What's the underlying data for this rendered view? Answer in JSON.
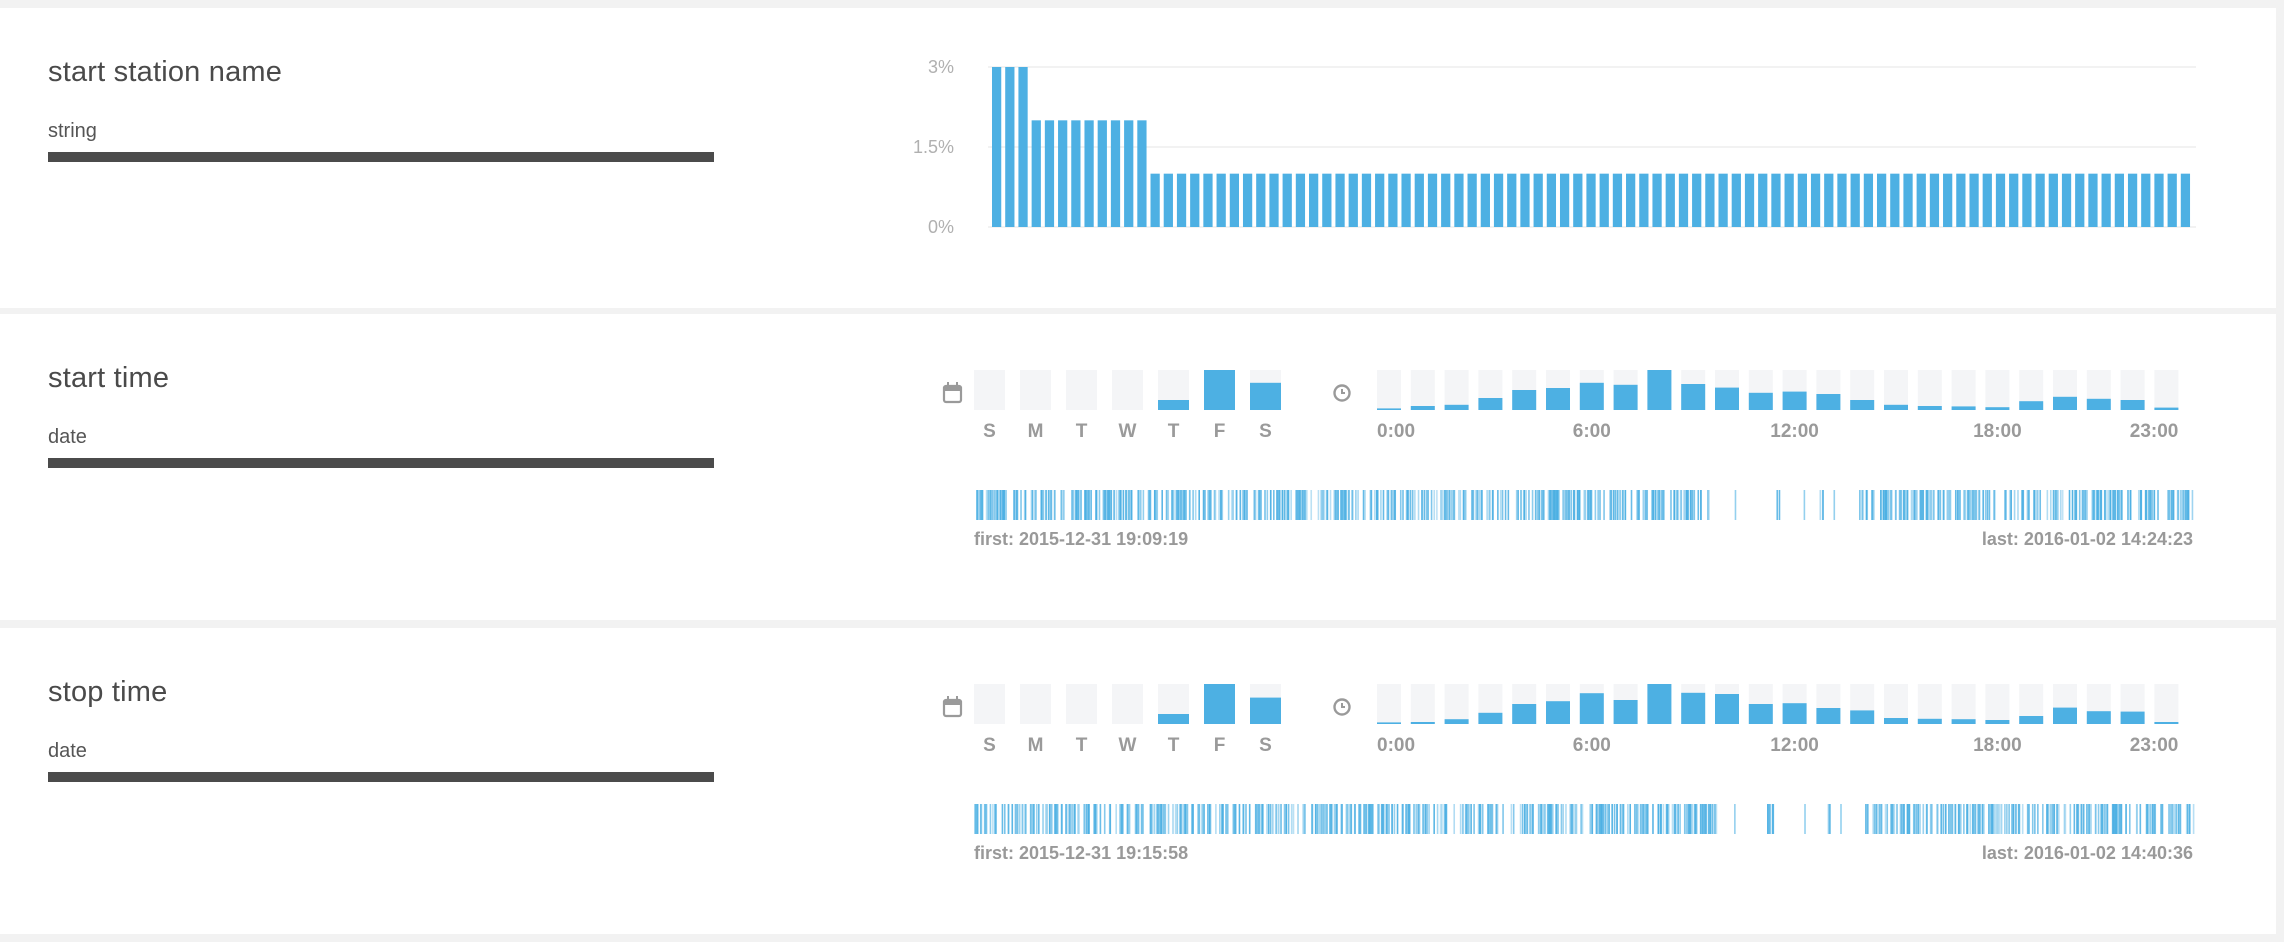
{
  "fields": [
    {
      "name": "start station name",
      "type": "string",
      "chart_data": {
        "type": "bar",
        "yticks": [
          "3%",
          "1.5%",
          "0%"
        ],
        "ylim": [
          0,
          3
        ],
        "values": [
          3,
          3,
          3,
          2,
          2,
          2,
          2,
          2,
          2,
          2,
          2,
          2,
          1,
          1,
          1,
          1,
          1,
          1,
          1,
          1,
          1,
          1,
          1,
          1,
          1,
          1,
          1,
          1,
          1,
          1,
          1,
          1,
          1,
          1,
          1,
          1,
          1,
          1,
          1,
          1,
          1,
          1,
          1,
          1,
          1,
          1,
          1,
          1,
          1,
          1,
          1,
          1,
          1,
          1,
          1,
          1,
          1,
          1,
          1,
          1,
          1,
          1,
          1,
          1,
          1,
          1,
          1,
          1,
          1,
          1,
          1,
          1,
          1,
          1,
          1,
          1,
          1,
          1,
          1,
          1,
          1,
          1,
          1,
          1,
          1,
          1,
          1,
          1,
          1,
          1,
          1
        ],
        "color": "#4db0e3"
      }
    },
    {
      "name": "start time",
      "type": "date",
      "weekday": {
        "labels": [
          "S",
          "M",
          "T",
          "W",
          "T",
          "F",
          "S"
        ],
        "values": [
          0,
          0,
          0,
          0,
          0.25,
          1.0,
          0.68
        ]
      },
      "hour": {
        "labels": [
          "0:00",
          "6:00",
          "12:00",
          "18:00",
          "23:00"
        ],
        "values": [
          0.04,
          0.1,
          0.13,
          0.3,
          0.5,
          0.55,
          0.68,
          0.63,
          1.0,
          0.65,
          0.56,
          0.43,
          0.46,
          0.4,
          0.25,
          0.13,
          0.1,
          0.09,
          0.07,
          0.22,
          0.33,
          0.28,
          0.25,
          0.06
        ]
      },
      "first_label": "first: 2015-12-31 19:09:19",
      "last_label": "last: 2016-01-02 14:24:23",
      "rug_gaps": [
        [
          0.603,
          0.656
        ],
        [
          0.66,
          0.692
        ],
        [
          0.696,
          0.725
        ]
      ]
    },
    {
      "name": "stop time",
      "type": "date",
      "weekday": {
        "labels": [
          "S",
          "M",
          "T",
          "W",
          "T",
          "F",
          "S"
        ],
        "values": [
          0,
          0,
          0,
          0,
          0.25,
          1.0,
          0.66
        ]
      },
      "hour": {
        "labels": [
          "0:00",
          "6:00",
          "12:00",
          "18:00",
          "23:00"
        ],
        "values": [
          0.04,
          0.05,
          0.12,
          0.28,
          0.5,
          0.57,
          0.77,
          0.6,
          1.0,
          0.78,
          0.75,
          0.5,
          0.52,
          0.4,
          0.34,
          0.15,
          0.13,
          0.12,
          0.1,
          0.2,
          0.41,
          0.32,
          0.31,
          0.05
        ]
      },
      "first_label": "first: 2015-12-31 19:15:58",
      "last_label": "last: 2016-01-02 14:40:36",
      "rug_gaps": [
        [
          0.608,
          0.65
        ],
        [
          0.655,
          0.698
        ],
        [
          0.702,
          0.73
        ]
      ]
    }
  ]
}
